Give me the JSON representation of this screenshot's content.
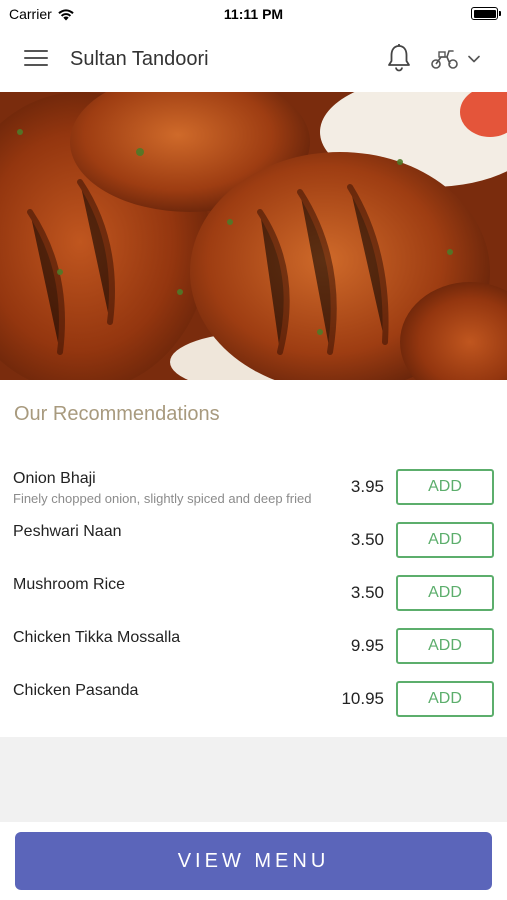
{
  "status_bar": {
    "carrier": "Carrier",
    "time": "11:11 PM"
  },
  "header": {
    "title": "Sultan Tandoori",
    "menu_icon": "hamburger-menu-icon",
    "notification_icon": "bell-icon",
    "delivery_icon": "scooter-icon",
    "dropdown_icon": "chevron-down-icon"
  },
  "hero": {
    "image": "tandoori-chicken-photo"
  },
  "recommendations": {
    "title": "Our Recommendations",
    "add_label": "ADD",
    "items": [
      {
        "name": "Onion Bhaji",
        "description": "Finely chopped onion, slightly spiced and deep fried",
        "price": "3.95"
      },
      {
        "name": "Peshwari Naan",
        "description": "",
        "price": "3.50"
      },
      {
        "name": "Mushroom Rice",
        "description": "",
        "price": "3.50"
      },
      {
        "name": "Chicken Tikka Mossalla",
        "description": "",
        "price": "9.95"
      },
      {
        "name": "Chicken Pasanda",
        "description": "",
        "price": "10.95"
      }
    ]
  },
  "footer": {
    "view_menu_label": "VIEW MENU"
  },
  "colors": {
    "accent_gold": "#a89a7e",
    "add_green": "#5cae6c",
    "button_blue": "#5b65ba"
  }
}
